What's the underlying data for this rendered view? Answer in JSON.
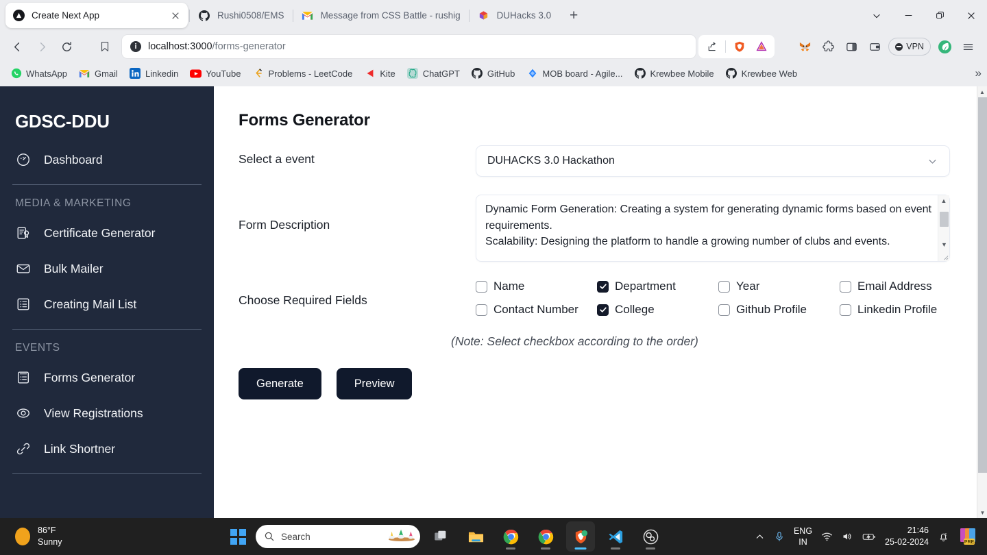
{
  "browser": {
    "tabs": [
      {
        "title": "Create Next App",
        "favicon": "nextjs-icon",
        "active": true,
        "closable": true
      },
      {
        "title": "Rushi0508/EMS",
        "favicon": "github-icon",
        "active": false
      },
      {
        "title": "Message from CSS Battle - rushigano",
        "favicon": "gmail-icon",
        "active": false
      },
      {
        "title": "DUHacks 3.0",
        "favicon": "duhacks-icon",
        "active": false
      }
    ],
    "new_tab_label": "+",
    "window_controls": [
      "tab-search-chevron",
      "minimize",
      "restore",
      "close"
    ],
    "nav": {
      "back": "back-arrow-icon",
      "forward": "forward-arrow-icon",
      "reload": "reload-icon",
      "bookmark": "bookmark-icon"
    },
    "url": {
      "host": "localhost:3000",
      "path": "/forms-generator",
      "full": "localhost:3000/forms-generator",
      "site_info": "info-icon"
    },
    "url_actions": [
      "share-icon",
      "brave-shields-icon",
      "bat-rewards-icon"
    ],
    "extensions": [
      "metamask-icon",
      "puzzle-extensions-icon",
      "sidebar-icon",
      "wallet-icon"
    ],
    "vpn_label": "VPN",
    "profile_icon": "leaf-profile-icon",
    "menu_icon": "hamburger-menu-icon",
    "bookmarks": [
      {
        "label": "WhatsApp",
        "icon": "whatsapp-icon"
      },
      {
        "label": "Gmail",
        "icon": "gmail-icon"
      },
      {
        "label": "Linkedin",
        "icon": "linkedin-icon"
      },
      {
        "label": "YouTube",
        "icon": "youtube-icon"
      },
      {
        "label": "Problems - LeetCode",
        "icon": "leetcode-icon"
      },
      {
        "label": "Kite",
        "icon": "kite-icon"
      },
      {
        "label": "ChatGPT",
        "icon": "chatgpt-icon"
      },
      {
        "label": "GitHub",
        "icon": "github-icon"
      },
      {
        "label": "MOB board - Agile...",
        "icon": "jira-icon"
      },
      {
        "label": "Krewbee Mobile",
        "icon": "github-icon"
      },
      {
        "label": "Krewbee Web",
        "icon": "github-icon"
      }
    ],
    "bookmarks_overflow": "»"
  },
  "sidebar": {
    "brand": "GDSC-DDU",
    "groups": [
      {
        "heading": null,
        "items": [
          {
            "label": "Dashboard",
            "icon": "speedometer-icon"
          }
        ]
      },
      {
        "heading": "MEDIA & MARKETING",
        "items": [
          {
            "label": "Certificate Generator",
            "icon": "certificate-icon"
          },
          {
            "label": "Bulk Mailer",
            "icon": "envelope-icon"
          },
          {
            "label": "Creating Mail List",
            "icon": "list-icon"
          }
        ]
      },
      {
        "heading": "EVENTS",
        "items": [
          {
            "label": "Forms Generator",
            "icon": "clipboard-form-icon"
          },
          {
            "label": "View Registrations",
            "icon": "eye-icon"
          },
          {
            "label": "Link Shortner",
            "icon": "link-icon"
          }
        ]
      }
    ]
  },
  "main": {
    "title": "Forms Generator",
    "event": {
      "label": "Select a event",
      "selected": "DUHACKS 3.0 Hackathon",
      "chevron": "chevron-down-icon"
    },
    "description": {
      "label": "Form Description",
      "value": "Dynamic Form Generation: Creating a system for generating dynamic forms based on event requirements.\nScalability: Designing the platform to handle a growing number of clubs and events."
    },
    "fields": {
      "label": "Choose Required Fields",
      "options": [
        {
          "label": "Name",
          "checked": false
        },
        {
          "label": "Department",
          "checked": true
        },
        {
          "label": "Year",
          "checked": false
        },
        {
          "label": "Email Address",
          "checked": false
        },
        {
          "label": "Contact Number",
          "checked": false
        },
        {
          "label": "College",
          "checked": true
        },
        {
          "label": "Github Profile",
          "checked": false
        },
        {
          "label": "Linkedin Profile",
          "checked": false
        }
      ]
    },
    "note": "(Note: Select checkbox according to the order)",
    "buttons": {
      "generate": "Generate",
      "preview": "Preview"
    }
  },
  "taskbar": {
    "weather": {
      "temp": "86°F",
      "condition": "Sunny"
    },
    "start": "windows-start-icon",
    "search_placeholder": "Search",
    "apps": [
      {
        "name": "task-view-icon",
        "active": false
      },
      {
        "name": "file-explorer-icon",
        "active": false
      },
      {
        "name": "chrome-icon",
        "active": false
      },
      {
        "name": "chrome-beta-icon",
        "active": false
      },
      {
        "name": "brave-browser-icon",
        "active": true
      },
      {
        "name": "vscode-icon",
        "active": false
      },
      {
        "name": "obs-studio-icon",
        "active": false
      }
    ],
    "tray": {
      "overflow": "show-hidden-icons-chevron",
      "mic": "microphone-icon",
      "language": "ENG",
      "region": "IN",
      "wifi": "wifi-icon",
      "volume": "speaker-icon",
      "battery": "battery-charging-icon",
      "time": "21:46",
      "date": "25-02-2024",
      "notifications": "notification-bell-muted-icon",
      "copilot": "pre-app-icon",
      "copilot_badge": "PRE"
    }
  },
  "colors": {
    "sidebar_bg": "#20293c",
    "button_bg": "#10192c",
    "checkbox_checked": "#141a2a",
    "accent_blue": "#41a5f5"
  }
}
